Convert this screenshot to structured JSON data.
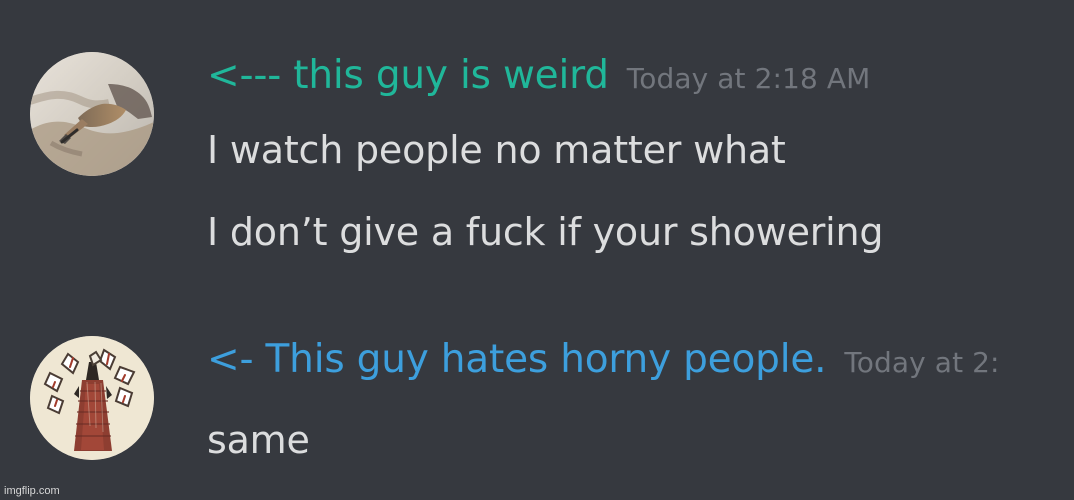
{
  "messages": [
    {
      "username": "<--- this guy is weird",
      "timestamp": "Today at 2:18 AM",
      "lines": [
        "I watch people no matter what",
        "I don’t give a fuck if your showering"
      ],
      "avatar_icon": "hand-photo-avatar"
    },
    {
      "username": "<- This guy hates horny people.",
      "timestamp": "Today at 2:",
      "lines": [
        "same"
      ],
      "avatar_icon": "drawing-avatar"
    }
  ],
  "watermark": "imgflip.com",
  "colors": {
    "background": "#36393f",
    "message_text": "#dcddde",
    "timestamp": "#72767d",
    "username_1": "#20b79a",
    "username_2": "#3d9fdd"
  }
}
